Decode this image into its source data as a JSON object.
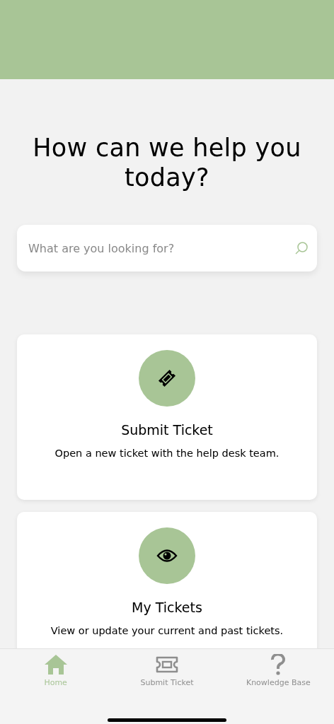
{
  "heading": "How can we help you today?",
  "search": {
    "placeholder": "What are you looking for?"
  },
  "cards": [
    {
      "title": "Submit Ticket",
      "description": "Open a new ticket with the help desk team."
    },
    {
      "title": "My Tickets",
      "description": "View or update your current and past tickets."
    }
  ],
  "tabs": [
    {
      "label": "Home",
      "selected": true
    },
    {
      "label": "Submit Ticket",
      "selected": false
    },
    {
      "label": "Knowledge Base",
      "selected": false
    }
  ]
}
